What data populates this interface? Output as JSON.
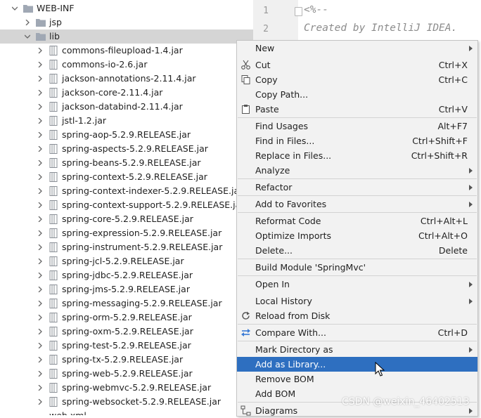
{
  "tree": {
    "web_inf": "WEB-INF",
    "jsp": "jsp",
    "lib": "lib",
    "jars": [
      "commons-fileupload-1.4.jar",
      "commons-io-2.6.jar",
      "jackson-annotations-2.11.4.jar",
      "jackson-core-2.11.4.jar",
      "jackson-databind-2.11.4.jar",
      "jstl-1.2.jar",
      "spring-aop-5.2.9.RELEASE.jar",
      "spring-aspects-5.2.9.RELEASE.jar",
      "spring-beans-5.2.9.RELEASE.jar",
      "spring-context-5.2.9.RELEASE.jar",
      "spring-context-indexer-5.2.9.RELEASE.jar",
      "spring-context-support-5.2.9.RELEASE.jar",
      "spring-core-5.2.9.RELEASE.jar",
      "spring-expression-5.2.9.RELEASE.jar",
      "spring-instrument-5.2.9.RELEASE.jar",
      "spring-jcl-5.2.9.RELEASE.jar",
      "spring-jdbc-5.2.9.RELEASE.jar",
      "spring-jms-5.2.9.RELEASE.jar",
      "spring-messaging-5.2.9.RELEASE.jar",
      "spring-orm-5.2.9.RELEASE.jar",
      "spring-oxm-5.2.9.RELEASE.jar",
      "spring-test-5.2.9.RELEASE.jar",
      "spring-tx-5.2.9.RELEASE.jar",
      "spring-web-5.2.9.RELEASE.jar",
      "spring-webmvc-5.2.9.RELEASE.jar",
      "spring-websocket-5.2.9.RELEASE.jar"
    ],
    "web_xml": "web.xml"
  },
  "editor": {
    "line_numbers": [
      "1",
      "2"
    ],
    "lines": [
      "<%--",
      "  Created by IntelliJ IDEA."
    ]
  },
  "menu": {
    "items": [
      {
        "label": "New",
        "shortcut": "",
        "submenu": true,
        "icon": ""
      },
      {
        "label": "Cut",
        "shortcut": "Ctrl+X",
        "submenu": false,
        "icon": "scissors-icon"
      },
      {
        "label": "Copy",
        "shortcut": "Ctrl+C",
        "submenu": false,
        "icon": "copy-icon"
      },
      {
        "label": "Copy Path...",
        "shortcut": "",
        "submenu": false,
        "icon": ""
      },
      {
        "label": "Paste",
        "shortcut": "Ctrl+V",
        "submenu": false,
        "icon": "clipboard-icon"
      },
      {
        "label": "Find Usages",
        "shortcut": "Alt+F7",
        "submenu": false,
        "icon": ""
      },
      {
        "label": "Find in Files...",
        "shortcut": "Ctrl+Shift+F",
        "submenu": false,
        "icon": ""
      },
      {
        "label": "Replace in Files...",
        "shortcut": "Ctrl+Shift+R",
        "submenu": false,
        "icon": ""
      },
      {
        "label": "Analyze",
        "shortcut": "",
        "submenu": true,
        "icon": ""
      },
      {
        "label": "Refactor",
        "shortcut": "",
        "submenu": true,
        "icon": ""
      },
      {
        "label": "Add to Favorites",
        "shortcut": "",
        "submenu": true,
        "icon": ""
      },
      {
        "label": "Reformat Code",
        "shortcut": "Ctrl+Alt+L",
        "submenu": false,
        "icon": ""
      },
      {
        "label": "Optimize Imports",
        "shortcut": "Ctrl+Alt+O",
        "submenu": false,
        "icon": ""
      },
      {
        "label": "Delete...",
        "shortcut": "Delete",
        "submenu": false,
        "icon": ""
      },
      {
        "label": "Build Module 'SpringMvc'",
        "shortcut": "",
        "submenu": false,
        "icon": ""
      },
      {
        "label": "Open In",
        "shortcut": "",
        "submenu": true,
        "icon": ""
      },
      {
        "label": "Local History",
        "shortcut": "",
        "submenu": true,
        "icon": ""
      },
      {
        "label": "Reload from Disk",
        "shortcut": "",
        "submenu": false,
        "icon": "reload-icon"
      },
      {
        "label": "Compare With...",
        "shortcut": "Ctrl+D",
        "submenu": false,
        "icon": "compare-icon"
      },
      {
        "label": "Mark Directory as",
        "shortcut": "",
        "submenu": true,
        "icon": ""
      },
      {
        "label": "Add as Library...",
        "shortcut": "",
        "submenu": false,
        "icon": ""
      },
      {
        "label": "Remove BOM",
        "shortcut": "",
        "submenu": false,
        "icon": ""
      },
      {
        "label": "Add BOM",
        "shortcut": "",
        "submenu": false,
        "icon": ""
      },
      {
        "label": "Diagrams",
        "shortcut": "",
        "submenu": true,
        "icon": "diagram-icon"
      }
    ],
    "highlighted": "Add as Library..."
  },
  "watermark": "CSDN @weixin_46402513",
  "colors": {
    "menu_bg": "#f2f2f2",
    "highlight": "#2e6fc0",
    "tree_selection": "#d5d5d5",
    "folder": "#a0a8b4",
    "jar_icon": "#8a8f96"
  }
}
